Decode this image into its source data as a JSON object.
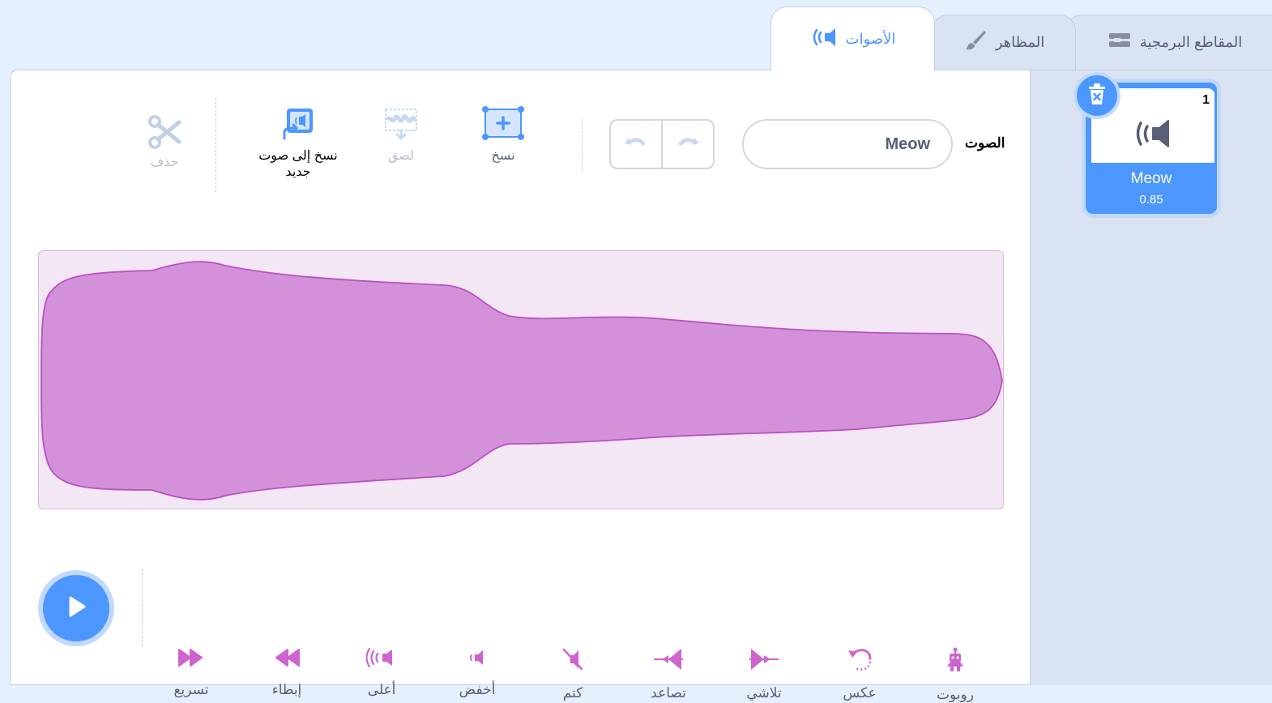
{
  "tabs": {
    "code": "المقاطع البرمجية",
    "costumes": "المظاهر",
    "sounds": "الأصوات"
  },
  "sound_name": {
    "label": "الصوت",
    "value": "Meow"
  },
  "toolbar": {
    "copy": "نسخ",
    "paste": "لصق",
    "copy_to_new_line1": "نسخ إلى صوت",
    "copy_to_new_line2": "جديد",
    "delete": "حذف"
  },
  "effects": {
    "faster": "تسريع",
    "slower": "إبطاء",
    "louder": "أعلى",
    "softer": "أخفض",
    "mute": "كتم",
    "fade_in": "تصاعد",
    "fade_out": "تلاشي",
    "reverse": "عكس",
    "robot": "روبوت"
  },
  "sound_list": [
    {
      "index": "1",
      "name": "Meow",
      "duration": "0.85"
    }
  ],
  "colors": {
    "accent": "#4c97ff",
    "waveform_fill": "#d391d9",
    "waveform_stroke": "#bb50c3",
    "waveform_bg": "#f3e6f5",
    "effect_icon": "#cf63cf"
  }
}
